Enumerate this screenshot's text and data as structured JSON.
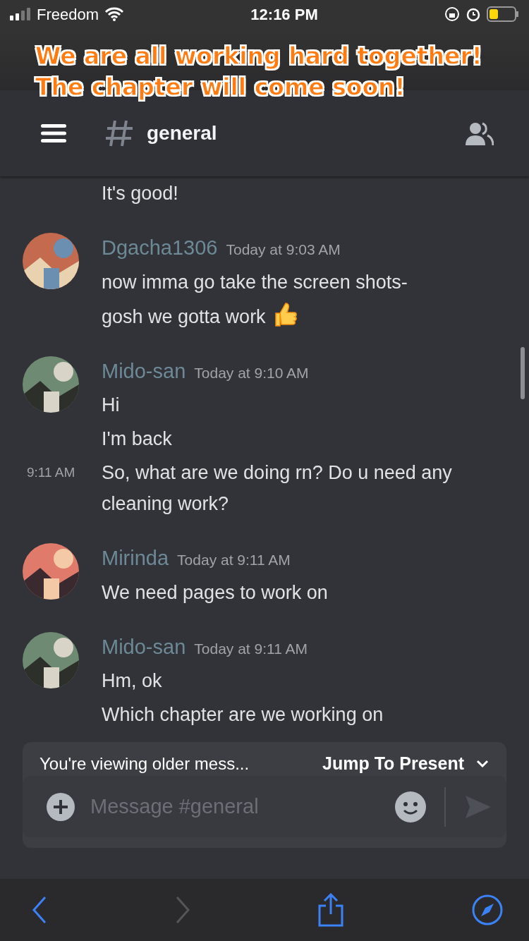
{
  "status_bar": {
    "carrier": "Freedom",
    "time": "12:16 PM"
  },
  "overlay_caption": [
    "We are all working hard together!",
    "The chapter will come soon!"
  ],
  "header": {
    "channel": "general"
  },
  "messages": [
    {
      "lines": [
        {
          "text": "It's good!"
        }
      ]
    },
    {
      "author": "Dgacha1306",
      "timestamp": "Today at 9:03 AM",
      "lines": [
        {
          "text": "now imma go take the screen shots-"
        },
        {
          "text": "gosh we gotta work",
          "thumbs_up": true
        }
      ]
    },
    {
      "author": "Mido-san",
      "timestamp": "Today at 9:10 AM",
      "lines": [
        {
          "text": "Hi"
        },
        {
          "text": "I'm back"
        },
        {
          "text": "So, what are we doing rn? Do u need any cleaning work?",
          "side_time": "9:11 AM"
        }
      ]
    },
    {
      "author": "Mirinda",
      "timestamp": "Today at 9:11 AM",
      "lines": [
        {
          "text": "We need pages to work on"
        }
      ]
    },
    {
      "author": "Mido-san",
      "timestamp": "Today at 9:11 AM",
      "lines": [
        {
          "text": "Hm, ok"
        },
        {
          "text": "Which chapter are we working on"
        }
      ]
    }
  ],
  "older_banner": {
    "text": "You're viewing older mess...",
    "action": "Jump To Present"
  },
  "composer": {
    "placeholder": "Message #general"
  }
}
